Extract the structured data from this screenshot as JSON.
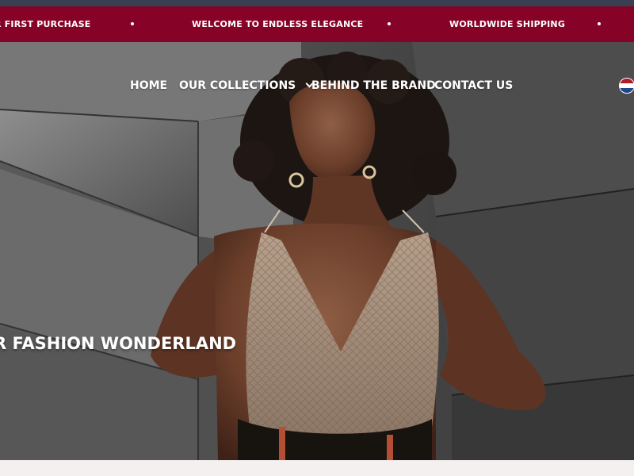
{
  "announcement_bar": {
    "background": "#860327",
    "items": [
      {
        "label": "R FIRST PURCHASE"
      },
      {
        "label": "WELCOME TO ENDLESS ELEGANCE"
      },
      {
        "label": "WORLDWIDE SHIPPING"
      }
    ]
  },
  "navigation": {
    "items": [
      {
        "label": "HOME"
      },
      {
        "label": "OUR COLLECTIONS",
        "icon": "chevron-down-icon"
      },
      {
        "label": "BEHIND THE BRAND"
      },
      {
        "label": "CONTACT US"
      }
    ],
    "language_icon": "netherlands-flag-icon"
  },
  "hero": {
    "headline": "R FASHION WONDERLAND"
  },
  "colors": {
    "accent": "#860327",
    "text_on_dark": "#ffffff"
  }
}
